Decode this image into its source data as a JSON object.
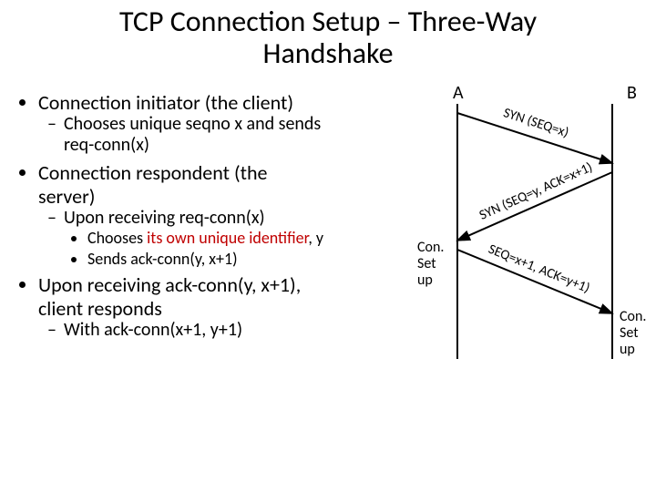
{
  "title": "TCP Connection Setup – Three-Way Handshake",
  "bullets": {
    "initiator": "Connection initiator (the client)",
    "initiator_sub1_a": "Chooses unique seqno x and sends",
    "initiator_sub1_b": "req-conn(x)",
    "respondent_a": "Connection respondent (the",
    "respondent_b": "server)",
    "respondent_sub1": "Upon receiving req-conn(x)",
    "respondent_sub1_b1_a": "Chooses ",
    "respondent_sub1_b1_red": "its own unique identifier",
    "respondent_sub1_b1_b": ", y",
    "respondent_sub1_b2": "Sends ack-conn(y, x+1)",
    "client_resp_a": "Upon receiving ack-conn(y, x+1),",
    "client_resp_b": "client responds",
    "client_resp_sub1": "With ack-conn(x+1, y+1)"
  },
  "diagram": {
    "hostA": "A",
    "hostB": "B",
    "msg1": "SYN (SEQ=x)",
    "msg2": "SYN (SEQ=y, ACK=x+1)",
    "msg3": "SEQ=x+1, ACK=y+1)",
    "labelA_1": "Con.",
    "labelA_2": "Set",
    "labelA_3": "up",
    "labelB_1": "Con.",
    "labelB_2": "Set",
    "labelB_3": "up"
  }
}
